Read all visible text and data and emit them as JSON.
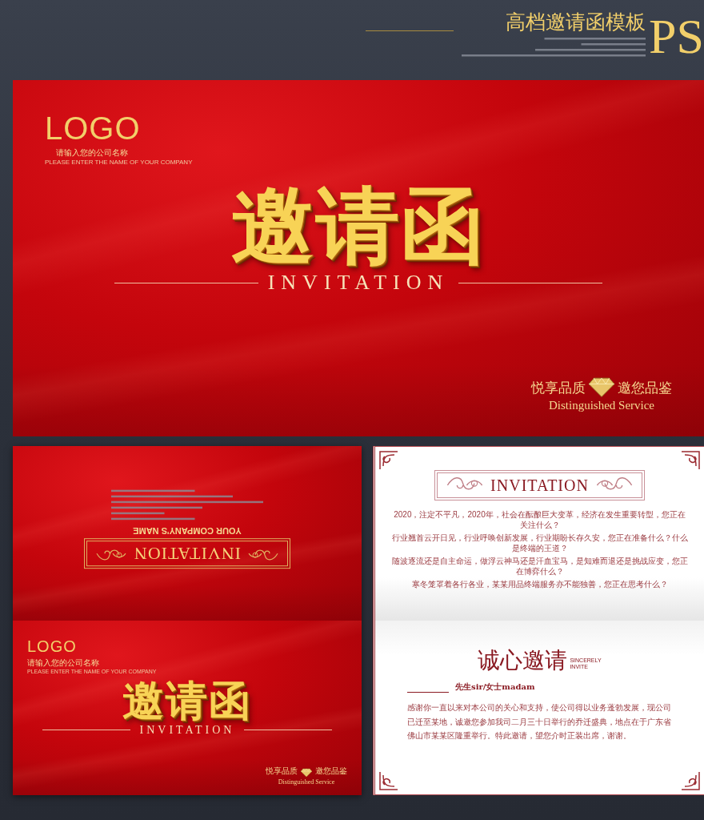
{
  "header": {
    "title": "高档邀请函模板",
    "tag": "PS"
  },
  "cover": {
    "logo": "LOGO",
    "company_prompt": "请输入您的公司名称",
    "company_prompt_en": "PLEASE ENTER THE NAME OF YOUR COMPANY",
    "title": "邀请函",
    "subtitle": "INVITATION",
    "slogan_left": "悦享品质",
    "slogan_right": "邀您品鉴",
    "slogan_en": "Distinguished Service"
  },
  "back_panel": {
    "heading": "INVITATION",
    "company": "YOUR COMPANY'S NAME"
  },
  "front_panel": {
    "logo": "LOGO",
    "company_prompt": "请输入您的公司名称",
    "company_prompt_en": "PLEASE ENTER THE NAME OF YOUR COMPANY",
    "title": "邀请函",
    "subtitle": "INVITATION",
    "slogan_left": "悦享品质",
    "slogan_right": "邀您品鉴",
    "slogan_en": "Distinguished Service"
  },
  "inner_top": {
    "heading": "INVITATION",
    "paragraph_lines": [
      "2020，注定不平凡，2020年，社会在酝酿巨大变革，经济在发生重要转型，您正在关注什么？",
      "行业翘首云开日见，行业呼唤创新发展，行业期盼长存久安，您正在准备什么？什么是终端的王道？",
      "随波逐流还是自主命运，做浮云神马还是汗血宝马，是知难而退还是挑战应变，您正在博弈什么？",
      "寒冬笼罩着各行各业，某某用品终端服务亦不能独善，您正在思考什么？"
    ]
  },
  "inner_bottom": {
    "title": "诚心邀请",
    "title_en_lines": [
      "SINCERELY",
      "INVITE"
    ],
    "salutation": "先生sir/女士madam",
    "body": "感谢你一直以来对本公司的关心和支持，使公司得以业务蓬勃发展，现公司已迁至某地，诚邀您参加我司二月三十日举行的乔迁盛典，地点在于广东省佛山市某某区隆重举行。特此邀请，望您介时正装出席，谢谢。"
  }
}
